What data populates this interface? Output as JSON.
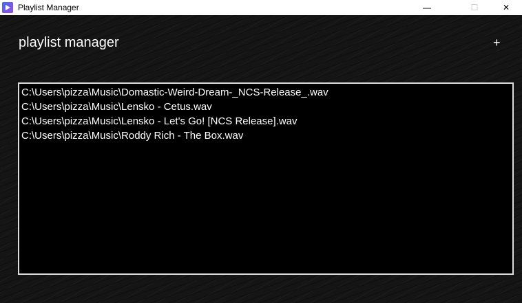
{
  "window": {
    "title": "Playlist Manager",
    "minimize": "—",
    "maximize": "☐",
    "close": "✕"
  },
  "header": {
    "title": "playlist manager",
    "add_label": "+"
  },
  "playlist": {
    "items": [
      "C:\\Users\\pizza\\Music\\Domastic-Weird-Dream-_NCS-Release_.wav",
      "C:\\Users\\pizza\\Music\\Lensko - Cetus.wav",
      "C:\\Users\\pizza\\Music\\Lensko - Let's Go! [NCS Release].wav",
      "C:\\Users\\pizza\\Music\\Roddy Rich - The Box.wav"
    ]
  }
}
